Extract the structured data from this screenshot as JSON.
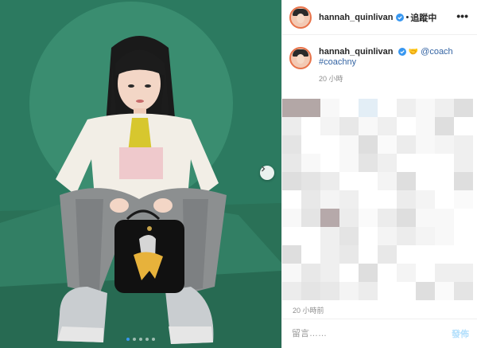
{
  "post": {
    "username": "hannah_quinlivan",
    "follow_label": "追蹤中",
    "separator": "•",
    "more_label": "•••"
  },
  "caption": {
    "username": "hannah_quinlivan",
    "emoji": "🤝",
    "mention": "@coach",
    "hashtag": "#coachny",
    "time": "20 小時"
  },
  "footer": {
    "timestamp": "20 小時前",
    "comment_placeholder": "留言……",
    "post_label": "發佈"
  },
  "carousel": {
    "dot_count": 5,
    "active_index": 0
  },
  "colors": {
    "background_green": "#2f7d63",
    "link_blue": "#3464a3",
    "verified_blue": "#3897f0",
    "post_button": "#b2dffc"
  }
}
